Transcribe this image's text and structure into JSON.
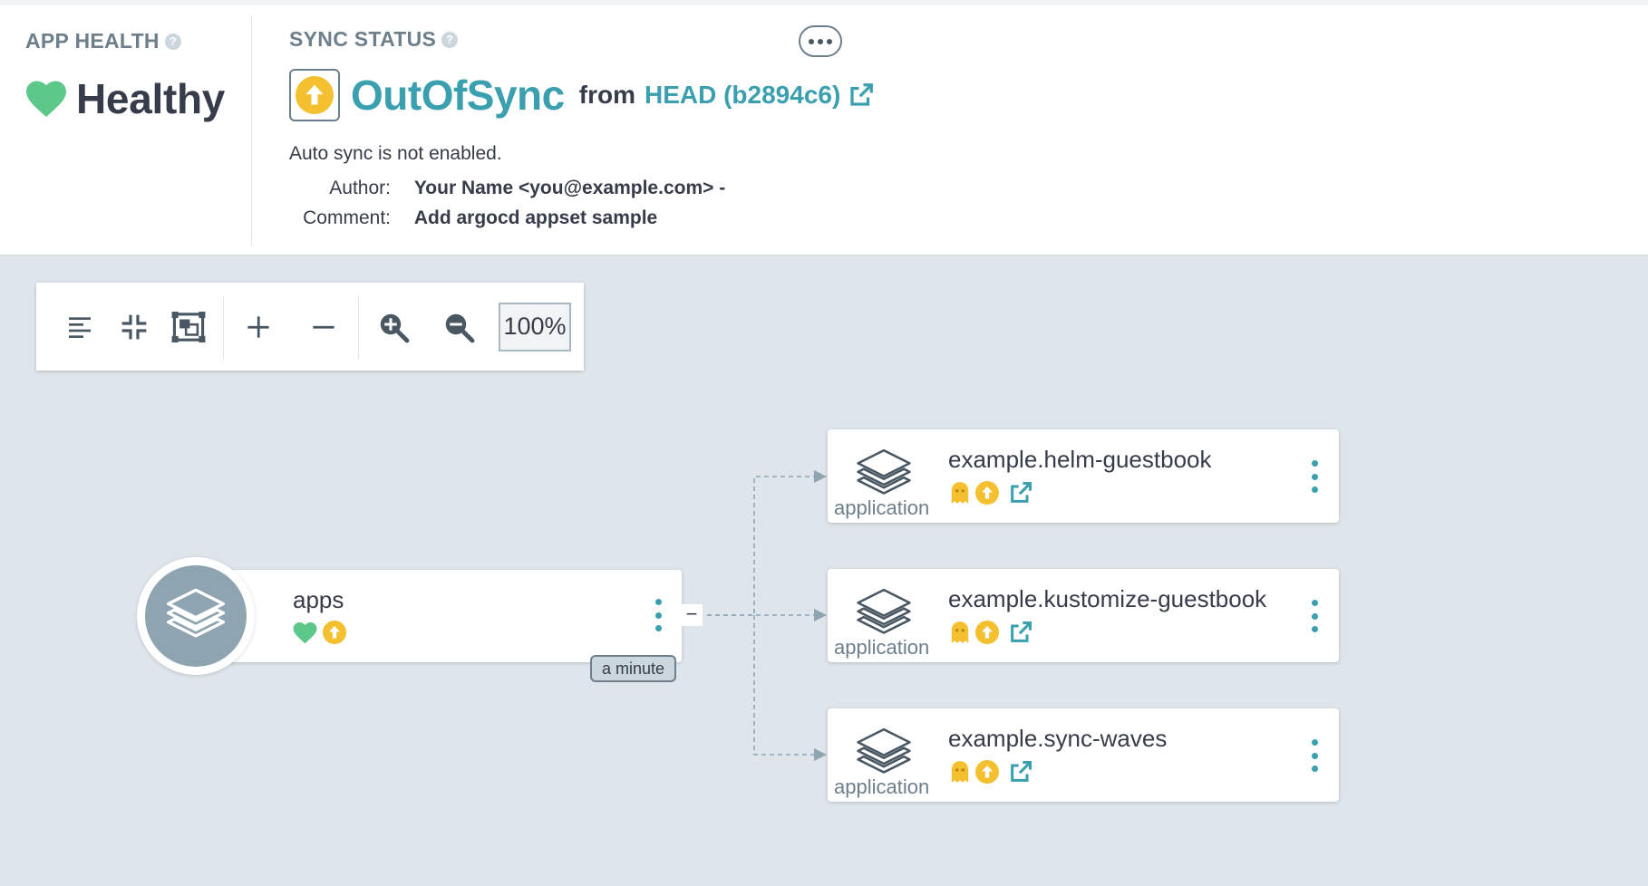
{
  "app_health": {
    "title": "APP HEALTH",
    "value": "Healthy",
    "color": "#5cc98b"
  },
  "sync_status": {
    "title": "SYNC STATUS",
    "value": "OutOfSync",
    "from_label": "from",
    "revision": "HEAD (b2894c6)",
    "auto_sync_text": "Auto sync is not enabled.",
    "author_label": "Author:",
    "author_value": "Your Name <you@example.com> -",
    "comment_label": "Comment:",
    "comment_value": "Add argocd appset sample",
    "more_button_icon": "ellipsis-icon",
    "color": "#3a9fae",
    "out_of_sync_color": "#f4c030"
  },
  "toolbar": {
    "buttons": [
      "align-left-icon",
      "compress-icon",
      "fit-screen-icon",
      "expand-all-icon",
      "collapse-all-icon",
      "zoom-in-icon",
      "zoom-out-icon"
    ],
    "zoom_level": "100%"
  },
  "graph": {
    "root": {
      "name": "apps",
      "health": "healthy",
      "sync": "out-of-sync",
      "age": "a minute",
      "collapse_symbol": "−"
    },
    "children": [
      {
        "name": "example.helm-guestbook",
        "kind": "application",
        "health": "missing",
        "sync": "out-of-sync"
      },
      {
        "name": "example.kustomize-guestbook",
        "kind": "application",
        "health": "missing",
        "sync": "out-of-sync"
      },
      {
        "name": "example.sync-waves",
        "kind": "application",
        "health": "missing",
        "sync": "out-of-sync"
      }
    ]
  }
}
